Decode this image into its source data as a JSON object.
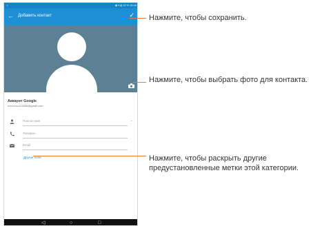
{
  "status_bar": {
    "time": "15:46",
    "battery": "18 %"
  },
  "app_bar": {
    "title": "Добавить контакт"
  },
  "account": {
    "title": "Аккаунт Google",
    "email": "xxxxxxxx123456@gmail.com"
  },
  "fields": [
    {
      "icon": "person-icon",
      "placeholder": "Полное имя"
    },
    {
      "icon": "phone-icon",
      "placeholder": "Телефон"
    },
    {
      "icon": "email-icon",
      "placeholder": "Email"
    }
  ],
  "more_fields_label": "Другие поля",
  "annotations": {
    "save": "Нажмите, чтобы сохранить.",
    "photo": "Нажмите, чтобы выбрать фото для контакта.",
    "more": "Нажмите, чтобы раскрыть другие предустановленные метки этой категории."
  },
  "colors": {
    "accent": "#1e8fd2",
    "photo_bg": "#5d8194",
    "callout": "#f07c2b"
  }
}
